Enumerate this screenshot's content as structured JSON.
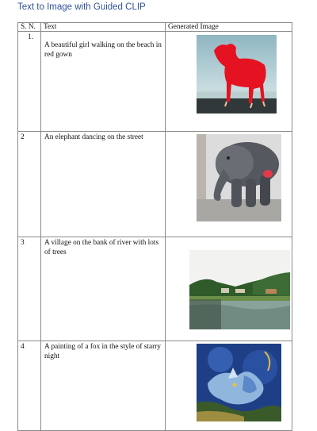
{
  "heading": "Text to Image with Guided CLIP",
  "columns": [
    "S. N.",
    "Text",
    "Generated Image"
  ],
  "rows": [
    {
      "sn": "1.",
      "text": "A beautiful girl walking on the beach in red gown",
      "image": "red-dog-on-beach"
    },
    {
      "sn": "2",
      "text": "An elephant dancing on the street",
      "image": "grey-elephant"
    },
    {
      "sn": "3",
      "text": "A village on the bank of river with lots of trees",
      "image": "village-river"
    },
    {
      "sn": "4",
      "text": "A painting of a fox in the style of starry night",
      "image": "fox-starry-night"
    }
  ]
}
